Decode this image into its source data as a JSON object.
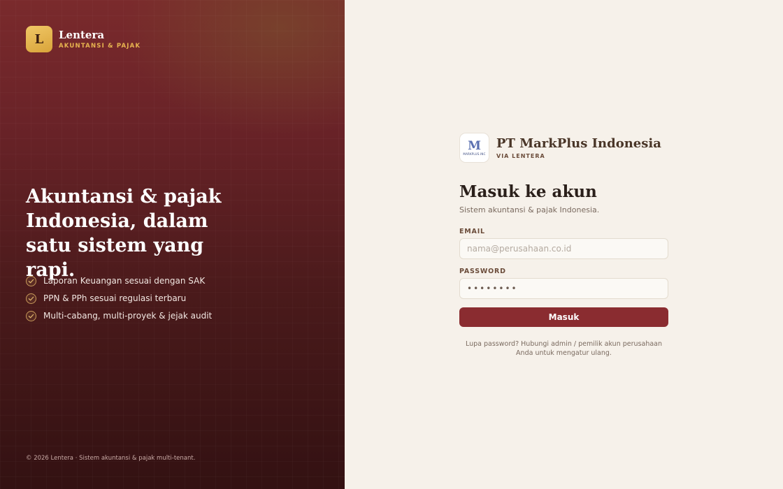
{
  "brand": {
    "logo_letter": "L",
    "name": "Lentera",
    "tagline": "AKUNTANSI & PAJAK"
  },
  "hero": {
    "headline": "Akuntansi & pajak Indonesia, dalam satu sistem yang rapi.",
    "features": [
      {
        "label": "Laporan Keuangan sesuai dengan SAK",
        "icon": "check-icon"
      },
      {
        "label": "PPN & PPh sesuai regulasi terbaru",
        "icon": "check-icon"
      },
      {
        "label": "Multi-cabang, multi-proyek & jejak audit",
        "icon": "check-icon"
      }
    ],
    "copyright": "© 2026 Lentera · Sistem akuntansi & pajak multi-tenant."
  },
  "company": {
    "logo_mark": "M",
    "logo_text": "MARKPLUS.INC",
    "name": "PT MarkPlus Indonesia",
    "via": "VIA LENTERA"
  },
  "login": {
    "title": "Masuk ke akun",
    "subtitle": "Sistem akuntansi & pajak Indonesia.",
    "email_label": "EMAIL",
    "email_placeholder": "nama@perusahaan.co.id",
    "email_value": "",
    "password_label": "PASSWORD",
    "password_value": "••••••••",
    "submit_label": "Masuk",
    "help_text": "Lupa password? Hubungi admin / pemilik akun perusahaan Anda untuk mengatur ulang."
  },
  "colors": {
    "accent": "#8a2c30",
    "gold": "#e6b34f",
    "panel_dark": "#4a1a1b",
    "background": "#f6f1ea"
  }
}
